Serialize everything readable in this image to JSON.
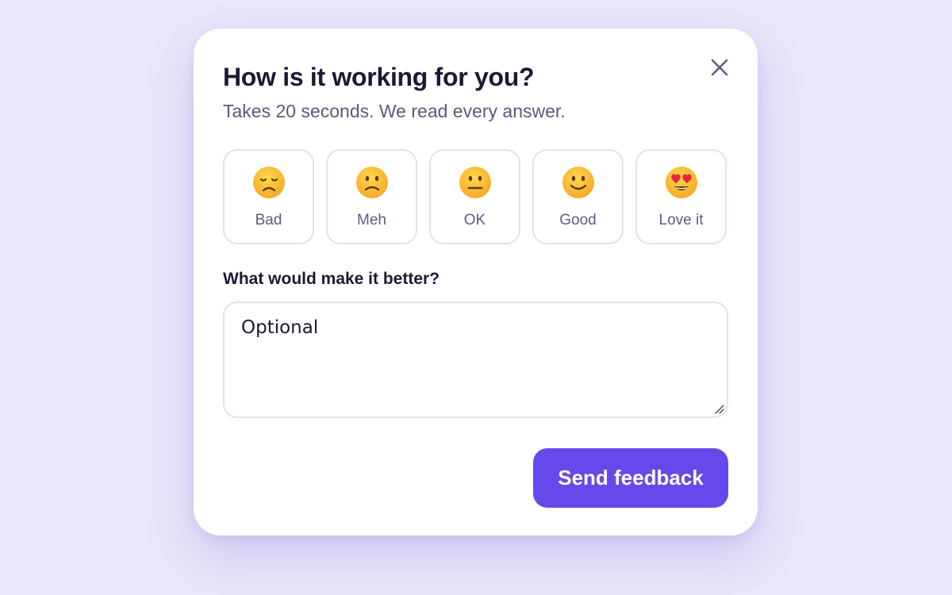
{
  "dialog": {
    "title": "How is it working for you?",
    "subtitle": "Takes 20 seconds. We read every answer.",
    "close_icon": "close-icon",
    "ratings": [
      {
        "label": "Bad",
        "icon": "disappointed-face-icon"
      },
      {
        "label": "Meh",
        "icon": "slightly-frowning-face-icon"
      },
      {
        "label": "OK",
        "icon": "neutral-face-icon"
      },
      {
        "label": "Good",
        "icon": "slightly-smiling-face-icon"
      },
      {
        "label": "Love it",
        "icon": "heart-eyes-face-icon"
      }
    ],
    "feedback_label": "What would make it better?",
    "feedback_placeholder": "Optional",
    "feedback_value": "",
    "submit_label": "Send feedback"
  },
  "colors": {
    "page_background": "#ebe6f9",
    "accent": "#6748ea",
    "title_text": "#1b1a33",
    "muted_text": "#5c5a78",
    "border": "#e3e1ee"
  }
}
